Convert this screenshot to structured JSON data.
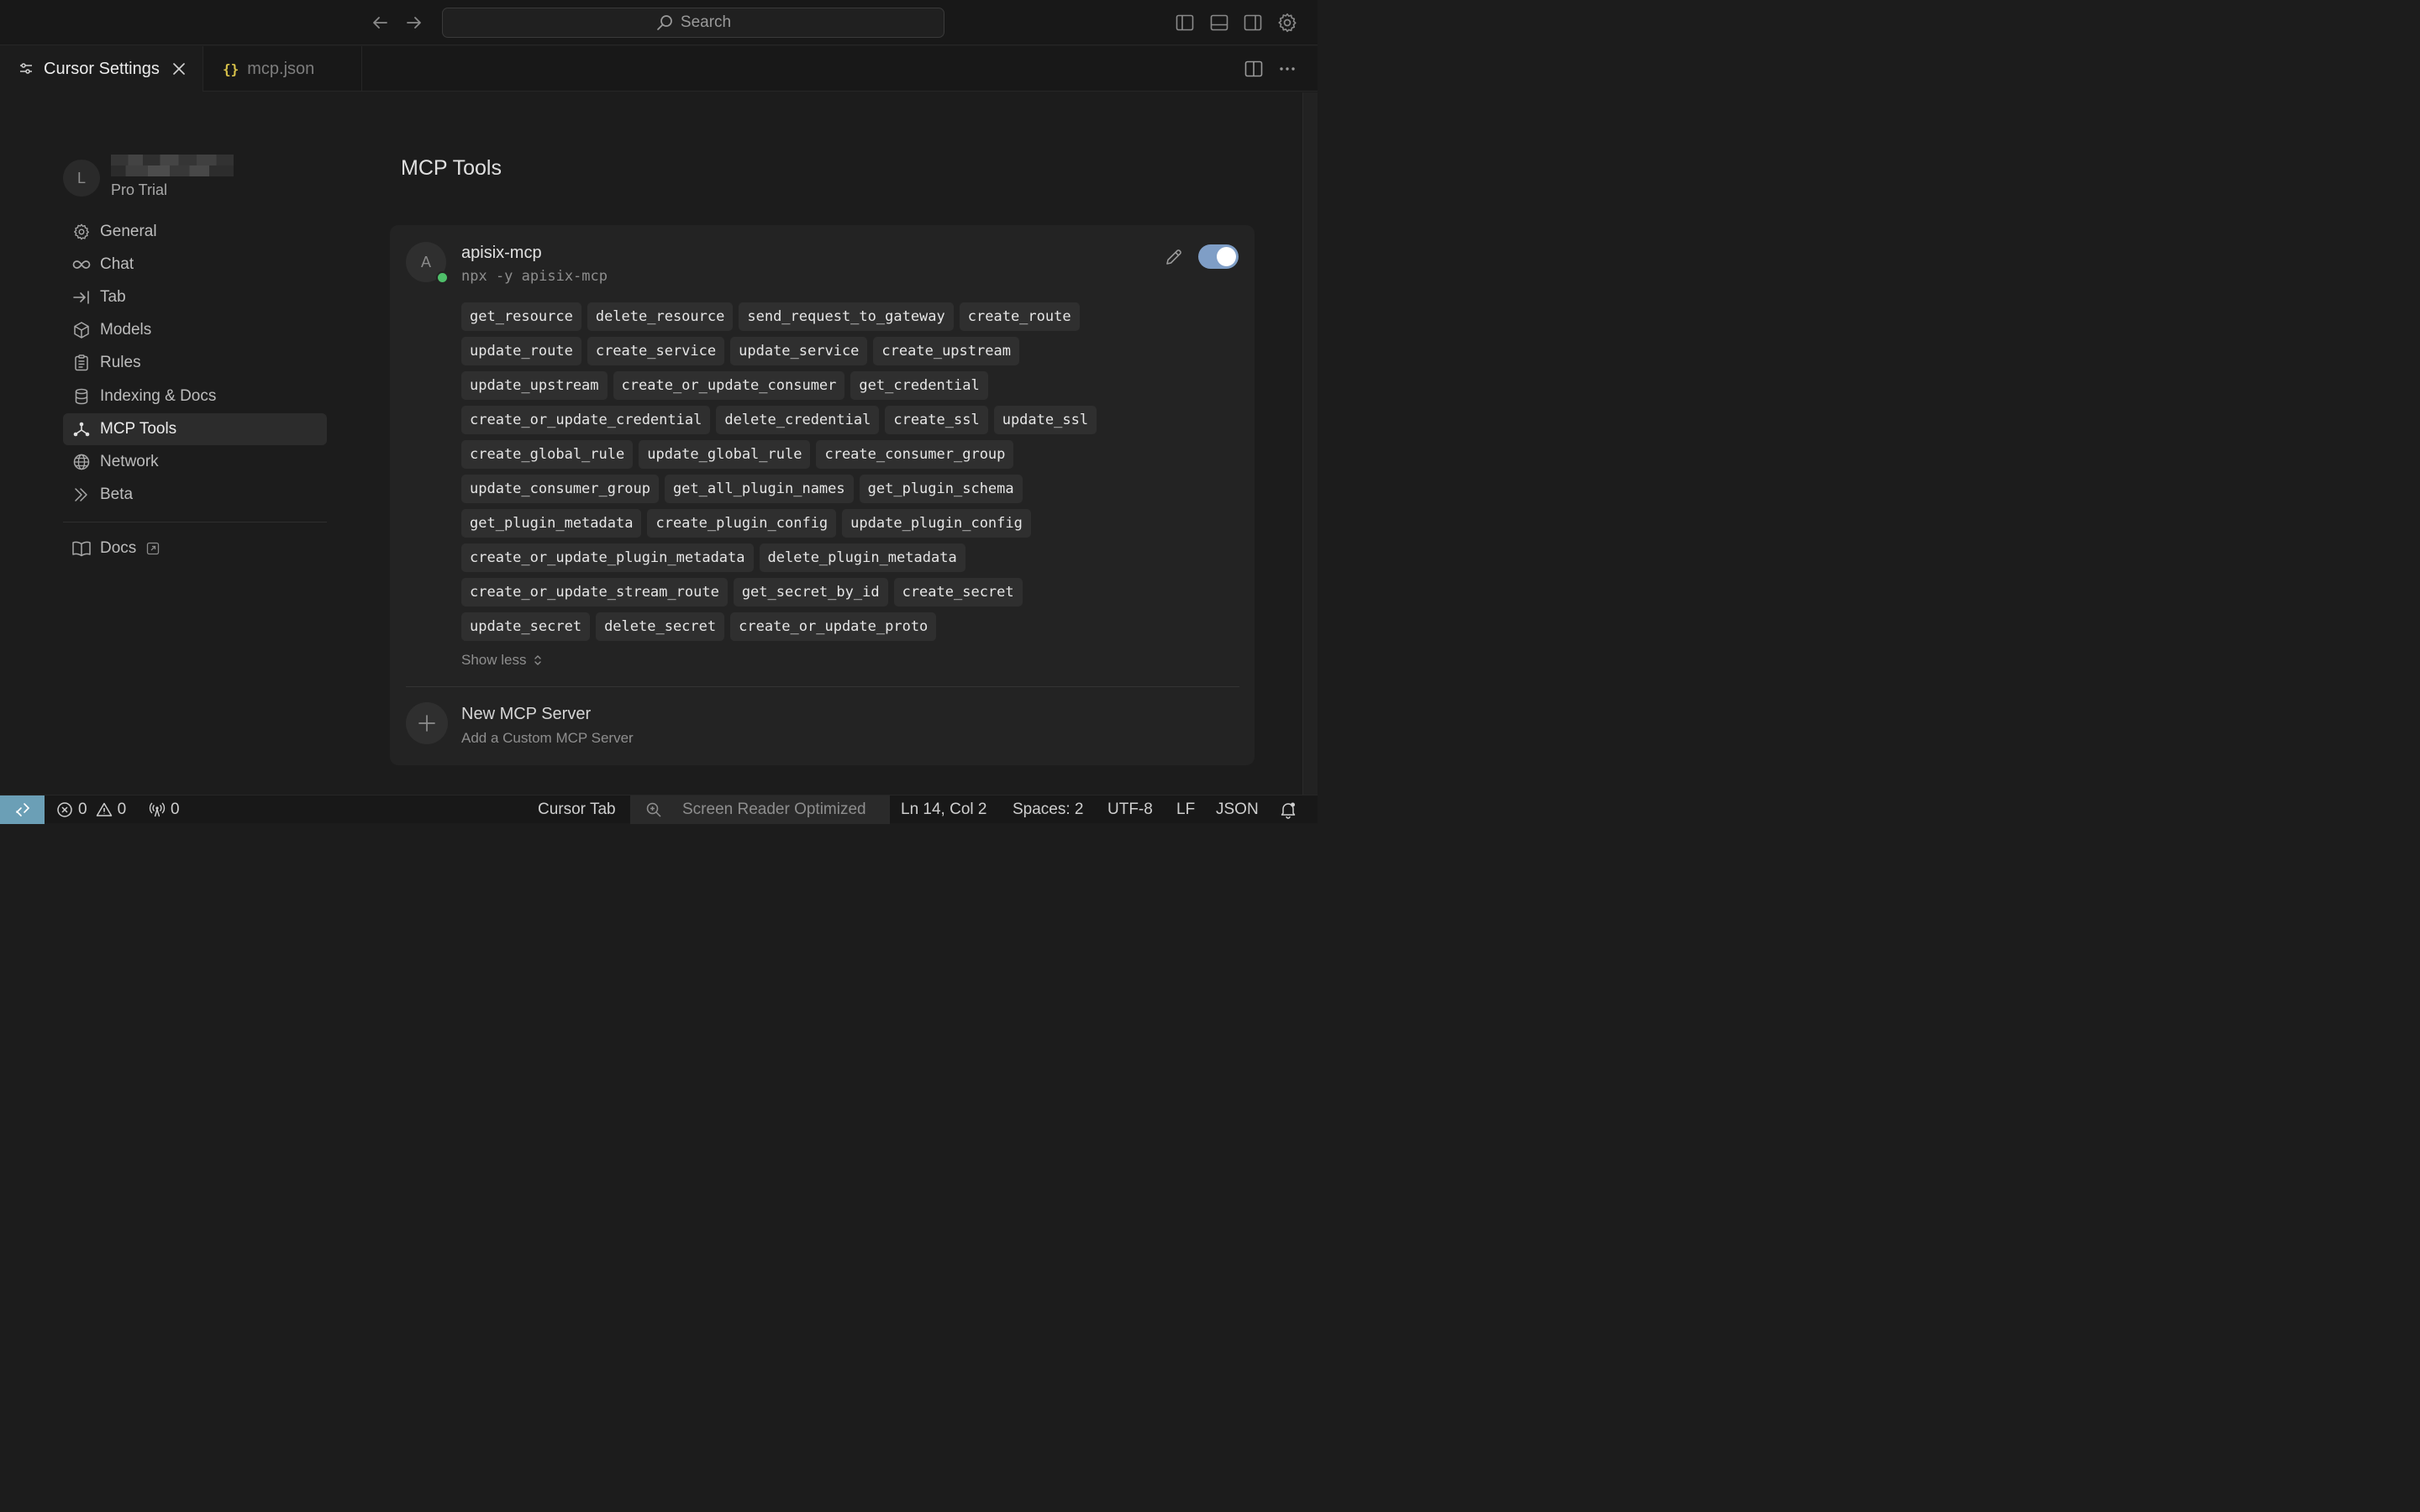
{
  "titlebar": {
    "search_placeholder": "Search"
  },
  "tabs": [
    {
      "label": "Cursor Settings",
      "active": true
    },
    {
      "label": "mcp.json",
      "active": false
    }
  ],
  "sidebar": {
    "avatar_initial": "L",
    "plan": "Pro Trial",
    "items": [
      {
        "label": "General",
        "icon": "gear-icon"
      },
      {
        "label": "Chat",
        "icon": "infinity-icon"
      },
      {
        "label": "Tab",
        "icon": "arrow-to-line-icon"
      },
      {
        "label": "Models",
        "icon": "cube-icon"
      },
      {
        "label": "Rules",
        "icon": "clipboard-icon"
      },
      {
        "label": "Indexing & Docs",
        "icon": "database-icon"
      },
      {
        "label": "MCP Tools",
        "icon": "network-nodes-icon",
        "active": true
      },
      {
        "label": "Network",
        "icon": "globe-icon"
      },
      {
        "label": "Beta",
        "icon": "double-chevron-icon"
      }
    ],
    "docs_label": "Docs"
  },
  "main": {
    "title": "MCP Tools",
    "server": {
      "initial": "A",
      "name": "apisix-mcp",
      "command": "npx -y apisix-mcp",
      "enabled": true,
      "tools": [
        "get_resource",
        "delete_resource",
        "send_request_to_gateway",
        "create_route",
        "update_route",
        "create_service",
        "update_service",
        "create_upstream",
        "update_upstream",
        "create_or_update_consumer",
        "get_credential",
        "create_or_update_credential",
        "delete_credential",
        "create_ssl",
        "update_ssl",
        "create_global_rule",
        "update_global_rule",
        "create_consumer_group",
        "update_consumer_group",
        "get_all_plugin_names",
        "get_plugin_schema",
        "get_plugin_metadata",
        "create_plugin_config",
        "update_plugin_config",
        "create_or_update_plugin_metadata",
        "delete_plugin_metadata",
        "create_or_update_stream_route",
        "get_secret_by_id",
        "create_secret",
        "update_secret",
        "delete_secret",
        "create_or_update_proto"
      ],
      "show_less": "Show less"
    },
    "new_server": {
      "title": "New MCP Server",
      "subtitle": "Add a Custom MCP Server"
    }
  },
  "statusbar": {
    "errors": "0",
    "warnings": "0",
    "ports": "0",
    "cursor_tab": "Cursor Tab",
    "screen_reader": "Screen Reader Optimized",
    "position": "Ln 14, Col 2",
    "spaces": "Spaces: 2",
    "encoding": "UTF-8",
    "eol": "LF",
    "language": "JSON"
  },
  "colors": {
    "accent_toggle": "#7f9ec6",
    "status_online": "#4fbf6a",
    "remote_indicator": "#6b9fb6",
    "json_braces": "#d8c24a"
  }
}
